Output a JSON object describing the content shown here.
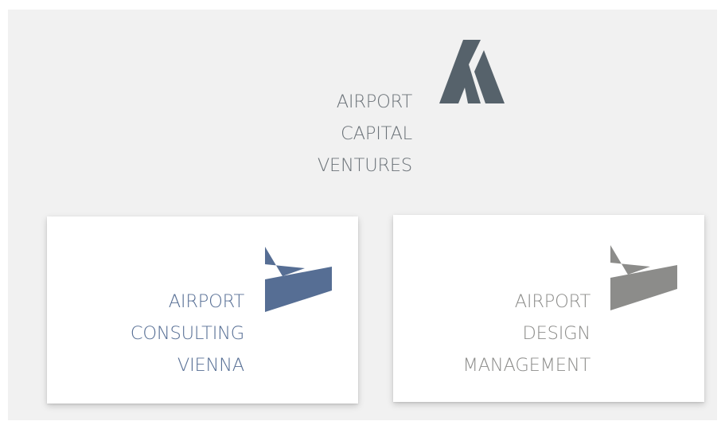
{
  "header": {
    "lines": [
      "AIRPORT",
      "CAPITAL",
      "VENTURES"
    ],
    "logo_icon": "triangle-a-icon",
    "text_color": "#6b7278",
    "logo_color": "#56626b"
  },
  "cards": [
    {
      "lines": [
        "AIRPORT",
        "CONSULTING",
        "VIENNA"
      ],
      "logo_icon": "chevron-arrow-icon",
      "color": "#566e94"
    },
    {
      "lines": [
        "AIRPORT",
        "DESIGN",
        "MANAGEMENT"
      ],
      "logo_icon": "chevron-arrow-icon",
      "color": "#8c8c8a"
    }
  ]
}
